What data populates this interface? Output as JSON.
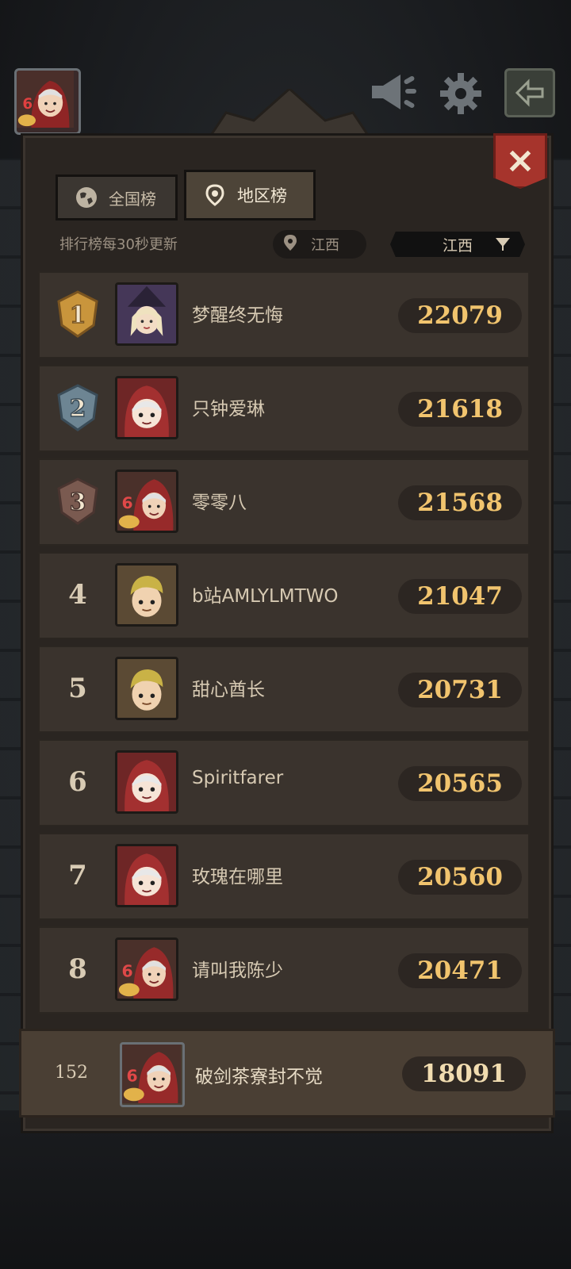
{
  "header": {
    "avatar_level": "6",
    "buttons": {
      "megaphone_icon": "megaphone-icon",
      "settings_icon": "gear-icon",
      "back_icon": "back-arrow-icon",
      "close_icon": "close-icon"
    }
  },
  "tabs": [
    {
      "label": "全国榜",
      "icon": "globe-icon",
      "active": false
    },
    {
      "label": "地区榜",
      "icon": "location-icon",
      "active": true
    }
  ],
  "update_note": "排行榜每30秒更新",
  "location": "江西",
  "region_select": "江西",
  "ranking": [
    {
      "rank": "1",
      "name": "梦醒终无悔",
      "score": "22079",
      "avatar": "witch"
    },
    {
      "rank": "2",
      "name": "只钟爱琳",
      "score": "21618",
      "avatar": "hood"
    },
    {
      "rank": "3",
      "name": "零零八",
      "score": "21568",
      "avatar": "hood6"
    },
    {
      "rank": "4",
      "name": "b站AMLYLMTWO",
      "score": "21047",
      "avatar": "boy"
    },
    {
      "rank": "5",
      "name": "甜心酋长",
      "score": "20731",
      "avatar": "boy"
    },
    {
      "rank": "6",
      "name": "Spiritfarer",
      "score": "20565",
      "avatar": "hood"
    },
    {
      "rank": "7",
      "name": "玫瑰在哪里",
      "score": "20560",
      "avatar": "hood"
    },
    {
      "rank": "8",
      "name": "请叫我陈少",
      "score": "20471",
      "avatar": "hood6"
    }
  ],
  "me": {
    "rank": "152",
    "name": "破剑茶寮封不觉",
    "score": "18091",
    "avatar": "hood6"
  },
  "colors": {
    "score_gold": "#f1c46e",
    "panel": "#2a2521",
    "close_red": "#a6342c"
  }
}
